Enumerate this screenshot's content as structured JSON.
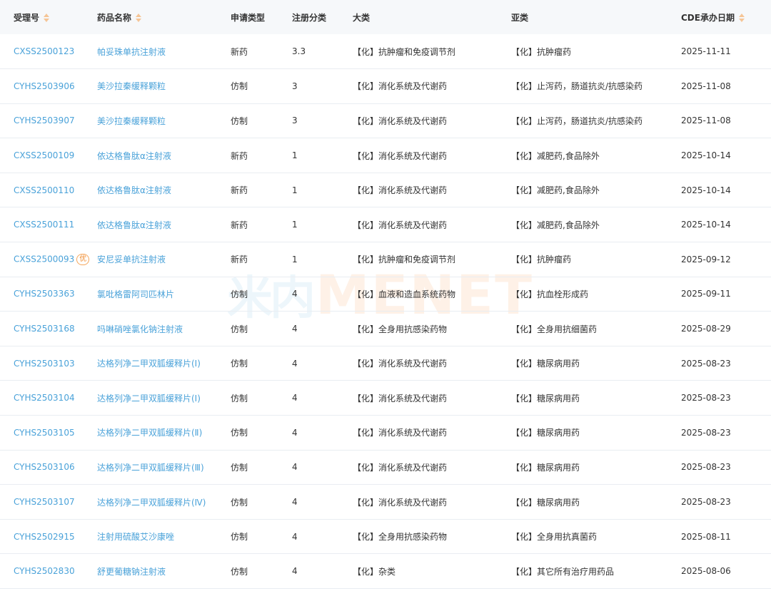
{
  "header": {
    "accept_no": "受理号",
    "drug_name": "药品名称",
    "apply_type": "申请类型",
    "reg_class": "注册分类",
    "category": "大类",
    "subcategory": "亚类",
    "cde_date": "CDE承办日期"
  },
  "rows": [
    {
      "accept_no": "CXSS2500123",
      "drug_name": "帕妥珠单抗注射液",
      "apply_type": "新药",
      "reg_class": "3.3",
      "category": "【化】抗肿瘤和免疫调节剂",
      "subcategory": "【化】抗肿瘤药",
      "cde_date": "2025-11-11"
    },
    {
      "accept_no": "CYHS2503906",
      "drug_name": "美沙拉秦缓释颗粒",
      "apply_type": "仿制",
      "reg_class": "3",
      "category": "【化】消化系统及代谢药",
      "subcategory": "【化】止泻药，肠道抗炎/抗感染药",
      "cde_date": "2025-11-08"
    },
    {
      "accept_no": "CYHS2503907",
      "drug_name": "美沙拉秦缓释颗粒",
      "apply_type": "仿制",
      "reg_class": "3",
      "category": "【化】消化系统及代谢药",
      "subcategory": "【化】止泻药，肠道抗炎/抗感染药",
      "cde_date": "2025-11-08"
    },
    {
      "accept_no": "CXSS2500109",
      "drug_name": "依达格鲁肽α注射液",
      "apply_type": "新药",
      "reg_class": "1",
      "category": "【化】消化系统及代谢药",
      "subcategory": "【化】减肥药,食品除外",
      "cde_date": "2025-10-14"
    },
    {
      "accept_no": "CXSS2500110",
      "drug_name": "依达格鲁肽α注射液",
      "apply_type": "新药",
      "reg_class": "1",
      "category": "【化】消化系统及代谢药",
      "subcategory": "【化】减肥药,食品除外",
      "cde_date": "2025-10-14"
    },
    {
      "accept_no": "CXSS2500111",
      "drug_name": "依达格鲁肽α注射液",
      "apply_type": "新药",
      "reg_class": "1",
      "category": "【化】消化系统及代谢药",
      "subcategory": "【化】减肥药,食品除外",
      "cde_date": "2025-10-14"
    },
    {
      "accept_no": "CXSS2500093",
      "badge": "优",
      "drug_name": "安尼妥单抗注射液",
      "apply_type": "新药",
      "reg_class": "1",
      "category": "【化】抗肿瘤和免疫调节剂",
      "subcategory": "【化】抗肿瘤药",
      "cde_date": "2025-09-12"
    },
    {
      "accept_no": "CYHS2503363",
      "drug_name": "氯吡格雷阿司匹林片",
      "apply_type": "仿制",
      "reg_class": "4",
      "category": "【化】血液和造血系统药物",
      "subcategory": "【化】抗血栓形成药",
      "cde_date": "2025-09-11"
    },
    {
      "accept_no": "CYHS2503168",
      "drug_name": "吗啉硝唑氯化钠注射液",
      "apply_type": "仿制",
      "reg_class": "4",
      "category": "【化】全身用抗感染药物",
      "subcategory": "【化】全身用抗细菌药",
      "cde_date": "2025-08-29"
    },
    {
      "accept_no": "CYHS2503103",
      "drug_name": "达格列净二甲双胍缓释片(Ⅰ)",
      "apply_type": "仿制",
      "reg_class": "4",
      "category": "【化】消化系统及代谢药",
      "subcategory": "【化】糖尿病用药",
      "cde_date": "2025-08-23"
    },
    {
      "accept_no": "CYHS2503104",
      "drug_name": "达格列净二甲双胍缓释片(Ⅰ)",
      "apply_type": "仿制",
      "reg_class": "4",
      "category": "【化】消化系统及代谢药",
      "subcategory": "【化】糖尿病用药",
      "cde_date": "2025-08-23"
    },
    {
      "accept_no": "CYHS2503105",
      "drug_name": "达格列净二甲双胍缓释片(Ⅱ)",
      "apply_type": "仿制",
      "reg_class": "4",
      "category": "【化】消化系统及代谢药",
      "subcategory": "【化】糖尿病用药",
      "cde_date": "2025-08-23"
    },
    {
      "accept_no": "CYHS2503106",
      "drug_name": "达格列净二甲双胍缓释片(Ⅲ)",
      "apply_type": "仿制",
      "reg_class": "4",
      "category": "【化】消化系统及代谢药",
      "subcategory": "【化】糖尿病用药",
      "cde_date": "2025-08-23"
    },
    {
      "accept_no": "CYHS2503107",
      "drug_name": "达格列净二甲双胍缓释片(Ⅳ)",
      "apply_type": "仿制",
      "reg_class": "4",
      "category": "【化】消化系统及代谢药",
      "subcategory": "【化】糖尿病用药",
      "cde_date": "2025-08-23"
    },
    {
      "accept_no": "CYHS2502915",
      "drug_name": "注射用硫酸艾沙康唑",
      "apply_type": "仿制",
      "reg_class": "4",
      "category": "【化】全身用抗感染药物",
      "subcategory": "【化】全身用抗真菌药",
      "cde_date": "2025-08-11"
    },
    {
      "accept_no": "CYHS2502830",
      "drug_name": "舒更葡糖钠注射液",
      "apply_type": "仿制",
      "reg_class": "4",
      "category": "【化】杂类",
      "subcategory": "【化】其它所有治疗用药品",
      "cde_date": "2025-08-06"
    }
  ],
  "watermark": {
    "cn": "米内",
    "en": "MENET"
  },
  "colors": {
    "link": "#4aa2d9",
    "header_bg": "#f6f8fa",
    "sort_icon": "#f5c596",
    "badge": "#f08a2d"
  }
}
